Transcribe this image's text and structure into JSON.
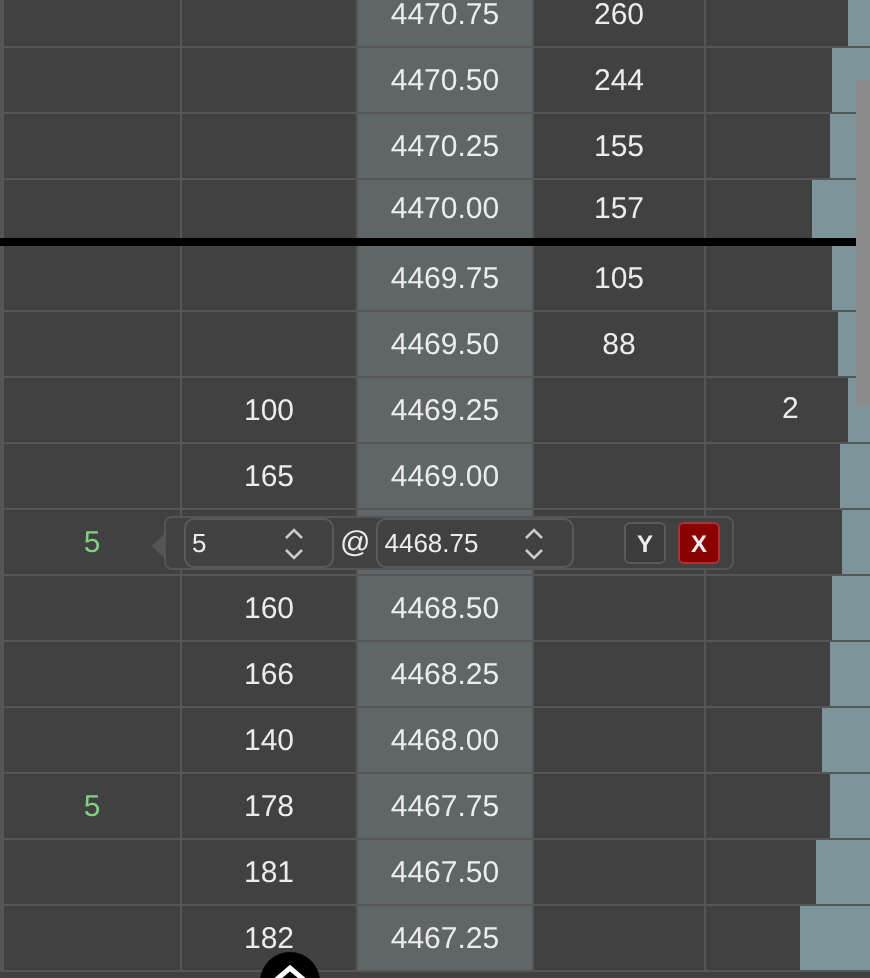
{
  "rows": [
    {
      "kind": "level",
      "col1": "",
      "col2": "",
      "price": "4470.75",
      "col4": "260",
      "col5": "",
      "level": 0.13,
      "divider_below": false
    },
    {
      "kind": "level",
      "col1": "",
      "col2": "",
      "price": "4470.50",
      "col4": "244",
      "col5": "",
      "level": 0.23,
      "divider_below": false
    },
    {
      "kind": "level",
      "col1": "",
      "col2": "",
      "price": "4470.25",
      "col4": "155",
      "col5": "",
      "level": 0.24,
      "divider_below": false
    },
    {
      "kind": "level",
      "col1": "",
      "col2": "",
      "price": "4470.00",
      "col4": "157",
      "col5": "",
      "level": 0.35,
      "divider_below": true
    },
    {
      "kind": "level",
      "col1": "",
      "col2": "",
      "price": "4469.75",
      "col4": "105",
      "col5": "",
      "level": 0.23,
      "divider_below": false
    },
    {
      "kind": "level",
      "col1": "",
      "col2": "",
      "price": "4469.50",
      "col4": "88",
      "col5": "",
      "level": 0.2,
      "divider_below": false
    },
    {
      "kind": "level",
      "col1": "",
      "col2": "100",
      "price": "4469.25",
      "col4": "",
      "col5": "2",
      "level": 0.14,
      "divider_below": false
    },
    {
      "kind": "level",
      "col1": "",
      "col2": "165",
      "price": "4469.00",
      "col4": "",
      "col5": "",
      "level": 0.18,
      "divider_below": false
    },
    {
      "kind": "order-edit",
      "col1": "5",
      "quantity": "5",
      "at": "@",
      "price": "4468.75",
      "confirm": "Y",
      "cancel": "X",
      "level": 0.17,
      "divider_below": false
    },
    {
      "kind": "level",
      "col1": "",
      "col2": "160",
      "price": "4468.50",
      "col4": "",
      "col5": "",
      "level": 0.23,
      "divider_below": false
    },
    {
      "kind": "level",
      "col1": "",
      "col2": "166",
      "price": "4468.25",
      "col4": "",
      "col5": "",
      "level": 0.24,
      "divider_below": false
    },
    {
      "kind": "level",
      "col1": "",
      "col2": "140",
      "price": "4468.00",
      "col4": "",
      "col5": "",
      "level": 0.29,
      "divider_below": false
    },
    {
      "kind": "level",
      "col1": "5",
      "col2": "178",
      "price": "4467.75",
      "col4": "",
      "col5": "",
      "level": 0.25,
      "divider_below": false
    },
    {
      "kind": "level",
      "col1": "",
      "col2": "181",
      "price": "4467.50",
      "col4": "",
      "col5": "",
      "level": 0.33,
      "divider_below": false
    },
    {
      "kind": "level",
      "col1": "",
      "col2": "182",
      "price": "4467.25",
      "col4": "",
      "col5": "",
      "level": 0.43,
      "divider_below": false
    }
  ]
}
